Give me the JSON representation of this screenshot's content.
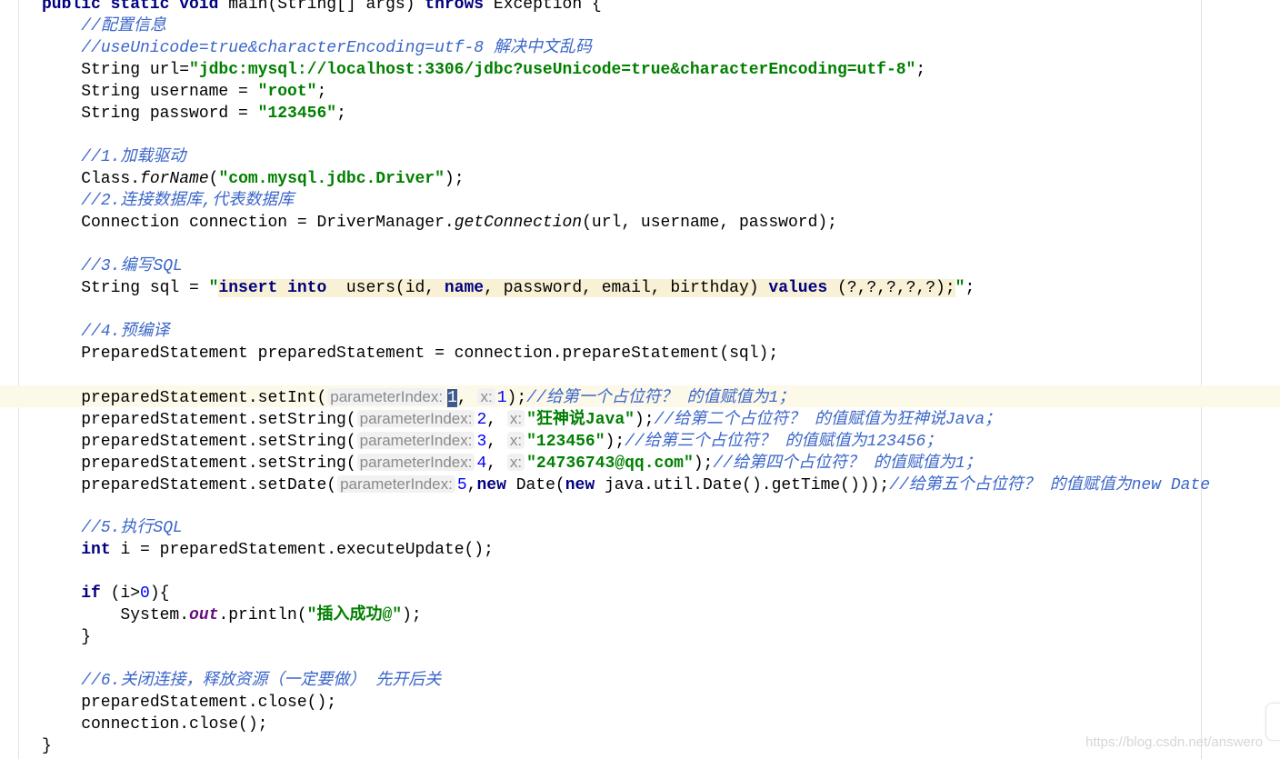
{
  "editor": {
    "lines": [
      [
        [
          "kw",
          "public static void "
        ],
        [
          "p",
          "main(String[] args) "
        ],
        [
          "kw",
          "throws "
        ],
        [
          "p",
          "Exception {"
        ]
      ],
      [
        [
          "p",
          "    "
        ],
        [
          "cm",
          "//配置信息"
        ]
      ],
      [
        [
          "p",
          "    "
        ],
        [
          "cm",
          "//useUnicode=true&characterEncoding=utf-8 解决中文乱码"
        ]
      ],
      [
        [
          "p",
          "    String url="
        ],
        [
          "str",
          "\"jdbc:mysql://localhost:3306/jdbc?useUnicode=true&characterEncoding=utf-8\""
        ],
        [
          "p",
          ";"
        ]
      ],
      [
        [
          "p",
          "    String username = "
        ],
        [
          "str",
          "\"root\""
        ],
        [
          "p",
          ";"
        ]
      ],
      [
        [
          "p",
          "    String password = "
        ],
        [
          "str",
          "\"123456\""
        ],
        [
          "p",
          ";"
        ]
      ],
      [],
      [
        [
          "p",
          "    "
        ],
        [
          "cm",
          "//1.加载驱动"
        ]
      ],
      [
        [
          "p",
          "    Class."
        ],
        [
          "it",
          "forName"
        ],
        [
          "p",
          "("
        ],
        [
          "str",
          "\"com.mysql.jdbc.Driver\""
        ],
        [
          "p",
          ");"
        ]
      ],
      [
        [
          "p",
          "    "
        ],
        [
          "cm",
          "//2.连接数据库,代表数据库"
        ]
      ],
      [
        [
          "p",
          "    Connection connection = DriverManager."
        ],
        [
          "it",
          "getConnection"
        ],
        [
          "p",
          "(url, username, password);"
        ]
      ],
      [],
      [
        [
          "p",
          "    "
        ],
        [
          "cm",
          "//3.编写SQL"
        ]
      ],
      [
        [
          "p",
          "    String sql = "
        ],
        [
          "str",
          "\""
        ],
        [
          "sqlkw",
          "insert into"
        ],
        [
          "sql",
          "  users(id, "
        ],
        [
          "sqlkw",
          "name"
        ],
        [
          "sql",
          ", password, email, birthday) "
        ],
        [
          "sqlkw",
          "values"
        ],
        [
          "sql",
          " (?,?,?,?,?);"
        ],
        [
          "str",
          "\""
        ],
        [
          "p",
          ";"
        ]
      ],
      [],
      [
        [
          "p",
          "    "
        ],
        [
          "cm",
          "//4.预编译"
        ]
      ],
      [
        [
          "p",
          "    PreparedStatement preparedStatement = connection.prepareStatement(sql);"
        ]
      ],
      [],
      [
        [
          "p",
          "    preparedStatement.setInt("
        ],
        [
          "hint",
          "parameterIndex:"
        ],
        [
          "sel",
          "1"
        ],
        [
          "p",
          ", "
        ],
        [
          "hint",
          "x:"
        ],
        [
          "num",
          "1"
        ],
        [
          "p",
          ");"
        ],
        [
          "cm",
          "//给第一个占位符？ 的值赋值为1；"
        ]
      ],
      [
        [
          "p",
          "    preparedStatement.setString("
        ],
        [
          "hint",
          "parameterIndex:"
        ],
        [
          "num",
          "2"
        ],
        [
          "p",
          ", "
        ],
        [
          "hint",
          "x:"
        ],
        [
          "str",
          "\"狂神说Java\""
        ],
        [
          "p",
          ");"
        ],
        [
          "cm",
          "//给第二个占位符？ 的值赋值为狂神说Java；"
        ]
      ],
      [
        [
          "p",
          "    preparedStatement.setString("
        ],
        [
          "hint",
          "parameterIndex:"
        ],
        [
          "num",
          "3"
        ],
        [
          "p",
          ", "
        ],
        [
          "hint",
          "x:"
        ],
        [
          "str",
          "\"123456\""
        ],
        [
          "p",
          ");"
        ],
        [
          "cm",
          "//给第三个占位符？ 的值赋值为123456；"
        ]
      ],
      [
        [
          "p",
          "    preparedStatement.setString("
        ],
        [
          "hint",
          "parameterIndex:"
        ],
        [
          "num",
          "4"
        ],
        [
          "p",
          ", "
        ],
        [
          "hint",
          "x:"
        ],
        [
          "str",
          "\"24736743@qq.com\""
        ],
        [
          "p",
          ");"
        ],
        [
          "cm",
          "//给第四个占位符？ 的值赋值为1；"
        ]
      ],
      [
        [
          "p",
          "    preparedStatement.setDate("
        ],
        [
          "hint",
          "parameterIndex:"
        ],
        [
          "num",
          "5"
        ],
        [
          "p",
          ","
        ],
        [
          "kw",
          "new "
        ],
        [
          "p",
          "Date("
        ],
        [
          "kw",
          "new "
        ],
        [
          "p",
          "java.util.Date().getTime()));"
        ],
        [
          "cm",
          "//给第五个占位符？ 的值赋值为new Date"
        ]
      ],
      [],
      [
        [
          "p",
          "    "
        ],
        [
          "cm",
          "//5.执行SQL"
        ]
      ],
      [
        [
          "p",
          "    "
        ],
        [
          "kw",
          "int "
        ],
        [
          "p",
          "i = preparedStatement.executeUpdate();"
        ]
      ],
      [],
      [
        [
          "p",
          "    "
        ],
        [
          "kw",
          "if "
        ],
        [
          "p",
          "(i>"
        ],
        [
          "num",
          "0"
        ],
        [
          "p",
          "){"
        ]
      ],
      [
        [
          "p",
          "        System."
        ],
        [
          "fld",
          "out"
        ],
        [
          "p",
          ".println("
        ],
        [
          "str",
          "\"插入成功@\""
        ],
        [
          "p",
          ");"
        ]
      ],
      [
        [
          "p",
          "    }"
        ]
      ],
      [],
      [
        [
          "p",
          "    "
        ],
        [
          "cm",
          "//6.关闭连接，释放资源（一定要做） 先开后关"
        ]
      ],
      [
        [
          "p",
          "    preparedStatement.close();"
        ]
      ],
      [
        [
          "p",
          "    connection.close();"
        ]
      ],
      [
        [
          "p",
          "}"
        ]
      ]
    ]
  },
  "watermark": "https://blog.csdn.net/answero",
  "colors": {
    "keyword": "#000080",
    "string": "#008000",
    "comment": "#3b66c9",
    "number": "#0000ff",
    "current_line": "#fdf9e8"
  }
}
